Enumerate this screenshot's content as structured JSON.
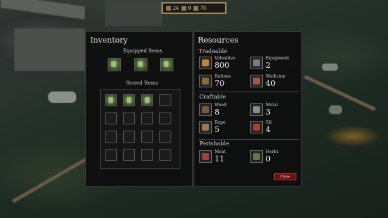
{
  "topbar": {
    "values": [
      "24",
      "0",
      "70"
    ]
  },
  "inventory": {
    "title": "Inventory",
    "equipped_title": "Equipped Items",
    "stored_title": "Stored Items",
    "equipped": [
      "item",
      "item",
      "item"
    ],
    "stored_filled_count": 3
  },
  "resources": {
    "title": "Resources",
    "sections": [
      {
        "title": "Tradeable",
        "items": [
          {
            "label": "Valuables",
            "value": "800",
            "icon": "valuables-icon",
            "color": "#b8863a"
          },
          {
            "label": "Equipment",
            "value": "2",
            "icon": "equipment-icon",
            "color": "#7a7a7a"
          },
          {
            "label": "Rations",
            "value": "70",
            "icon": "rations-icon",
            "color": "#8a6a3a"
          },
          {
            "label": "Medicine",
            "value": "40",
            "icon": "medicine-icon",
            "color": "#9a5a4a"
          }
        ]
      },
      {
        "title": "Craftable",
        "items": [
          {
            "label": "Wood",
            "value": "8",
            "icon": "wood-icon",
            "color": "#7a5a3a"
          },
          {
            "label": "Metal",
            "value": "3",
            "icon": "metal-icon",
            "color": "#8a8a8a"
          },
          {
            "label": "Rope",
            "value": "5",
            "icon": "rope-icon",
            "color": "#9a7a4a"
          },
          {
            "label": "Oil",
            "value": "4",
            "icon": "oil-icon",
            "color": "#a04030"
          }
        ]
      },
      {
        "title": "Perishable",
        "items": [
          {
            "label": "Meat",
            "value": "11",
            "icon": "meat-icon",
            "color": "#a0403a"
          },
          {
            "label": "Herbs",
            "value": "0",
            "icon": "herbs-icon",
            "color": "#5a7a4a"
          }
        ]
      }
    ],
    "close_label": "Close"
  }
}
